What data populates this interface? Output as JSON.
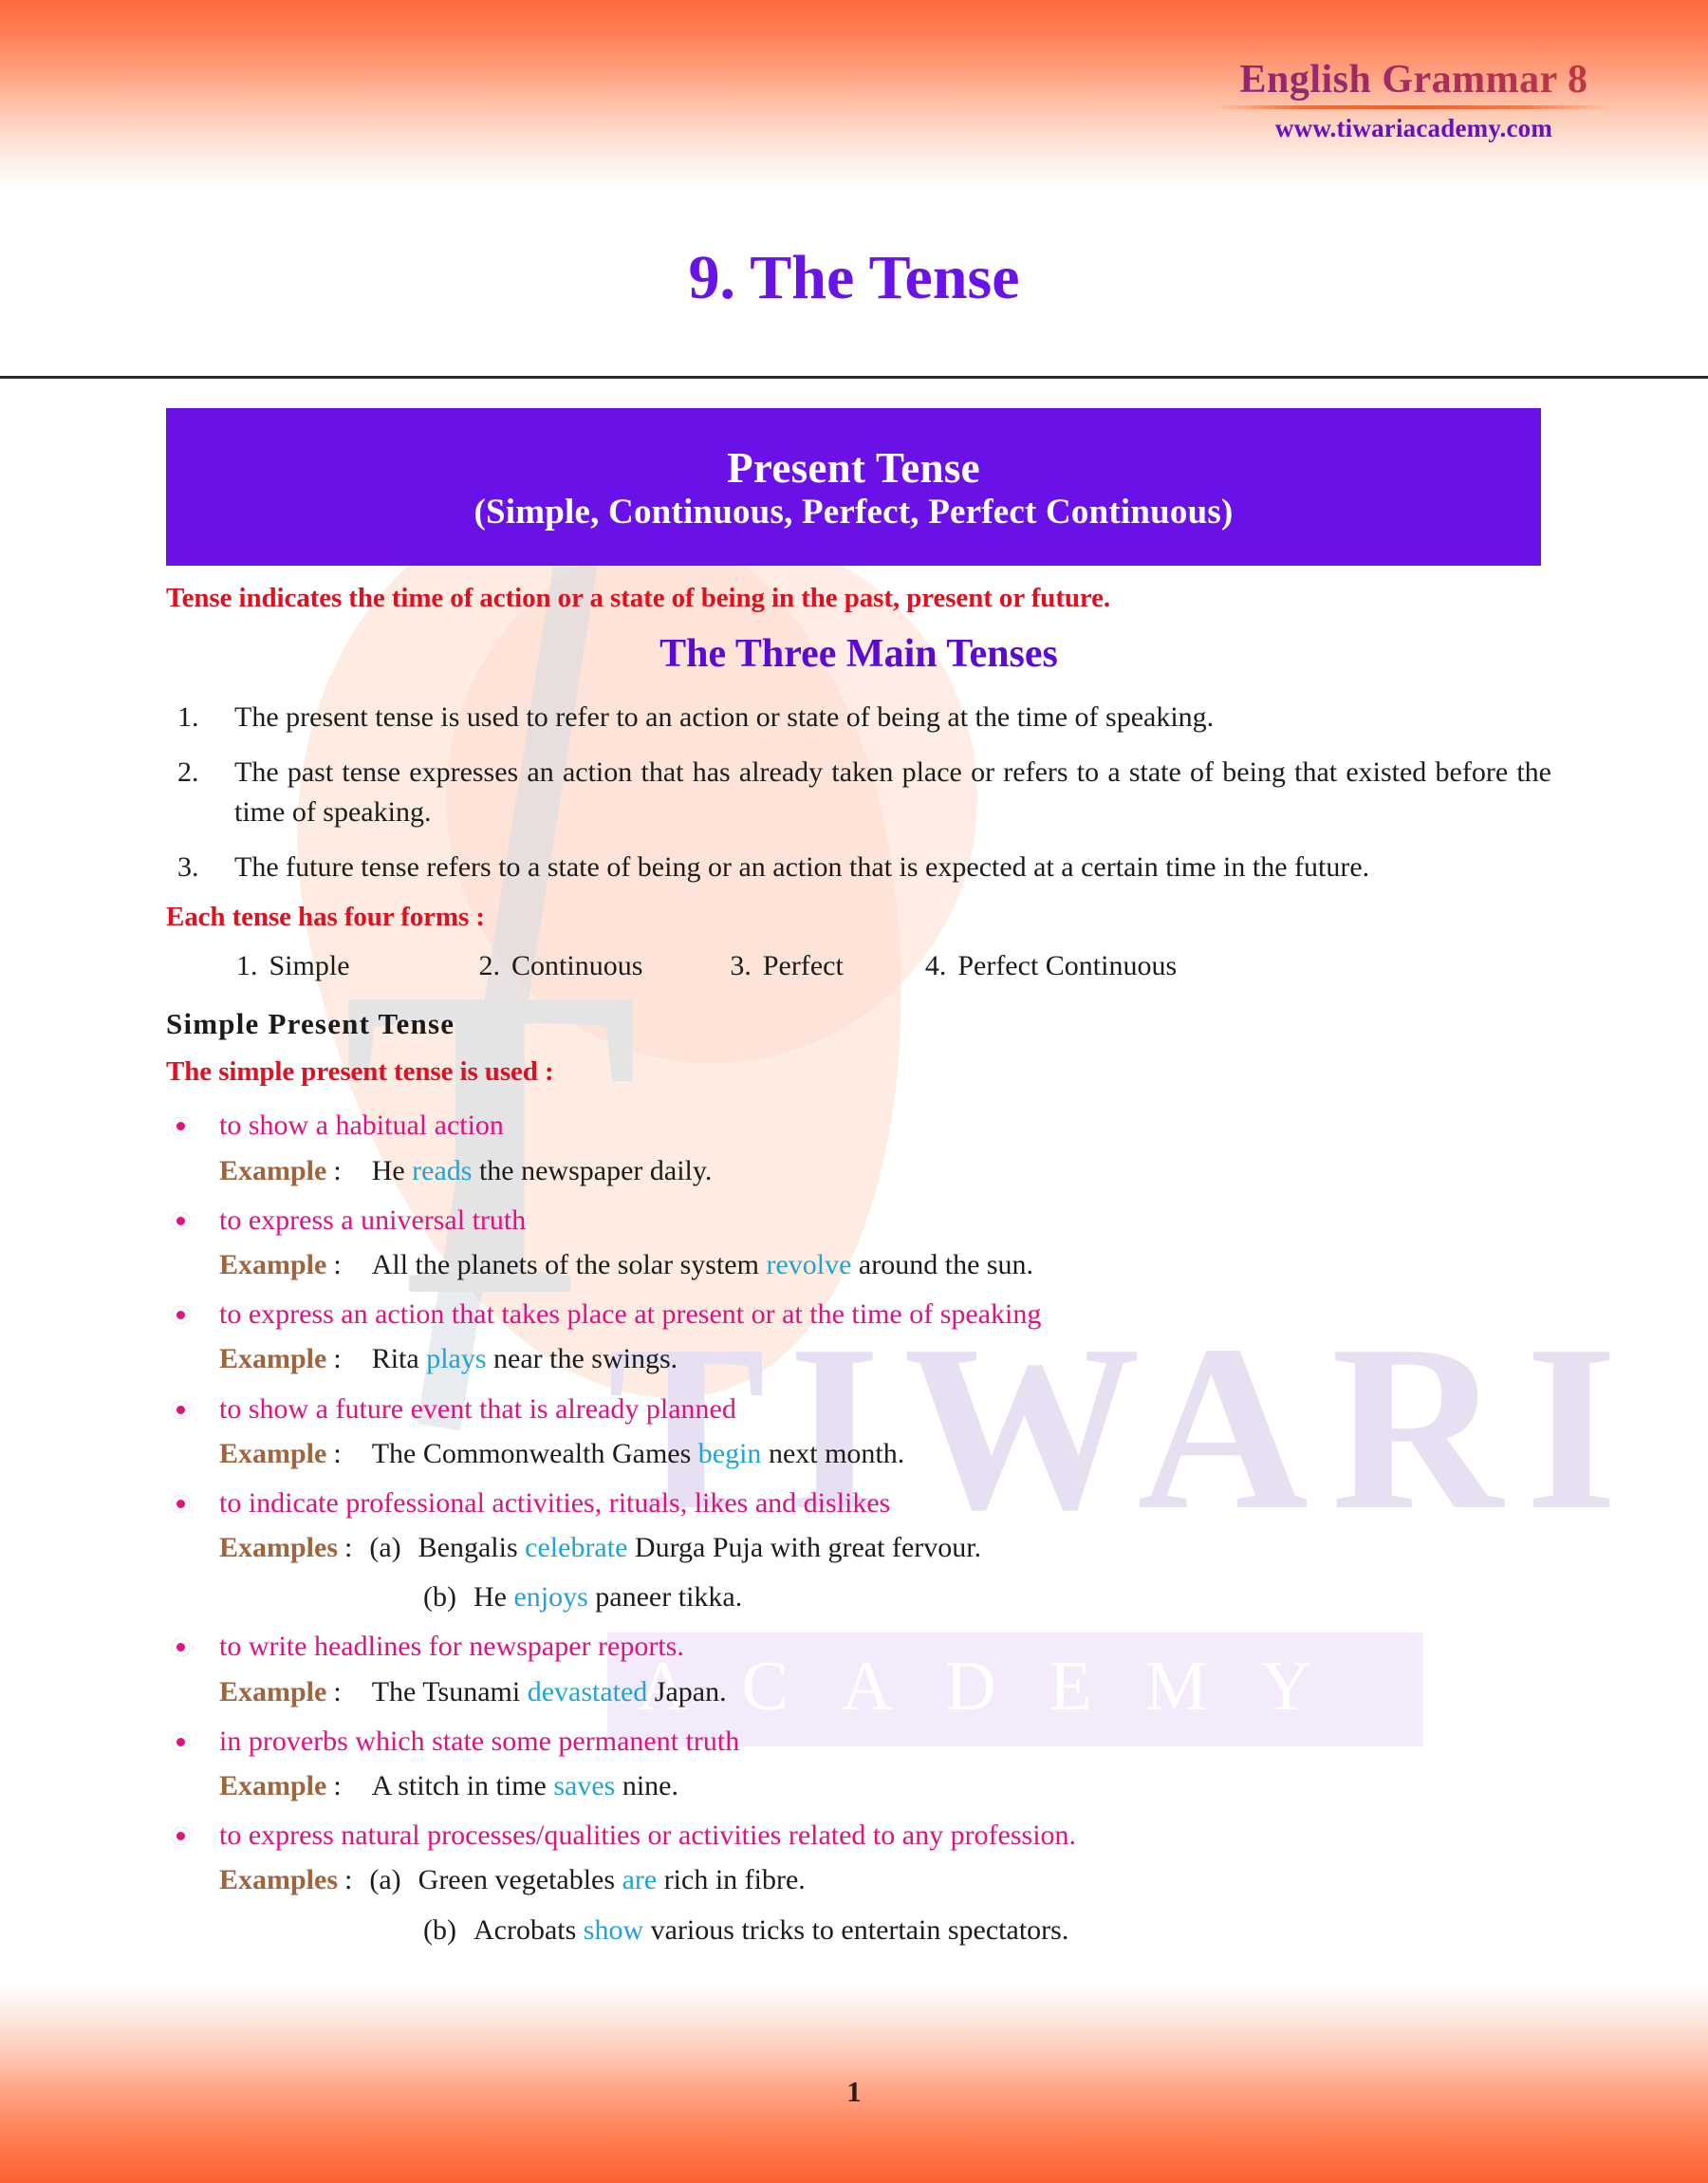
{
  "header": {
    "brand_title": "English Grammar 8",
    "brand_url": "www.tiwariacademy.com"
  },
  "chapter": {
    "title": "9. The Tense"
  },
  "banner": {
    "title": "Present Tense",
    "subtitle": "(Simple, Continuous, Perfect, Perfect Continuous)"
  },
  "intro": {
    "lead": "Tense indicates the time of action or a state of being in the past, present or future.",
    "section_heading": "The Three Main Tenses",
    "main_list": [
      "The present tense is used to refer to an action or state of being at the time of speaking.",
      "The past tense expresses an action that has already taken place or refers to a state of being that existed before the time of speaking.",
      "The future tense refers to a state of being or an action that is expected at a certain time in the future."
    ]
  },
  "forms": {
    "lead": "Each tense has four forms :",
    "items": [
      {
        "num": "1.",
        "label": "Simple"
      },
      {
        "num": "2.",
        "label": "Continuous"
      },
      {
        "num": "3.",
        "label": "Perfect"
      },
      {
        "num": "4.",
        "label": "Perfect Continuous"
      }
    ]
  },
  "simple_present": {
    "heading": "Simple Present Tense",
    "lead": "The simple present tense is used :",
    "bullets": [
      {
        "text": "to show a habitual action",
        "example_label": "Example",
        "examples": [
          {
            "marker": "",
            "before": "He ",
            "verb": "reads",
            "after": " the newspaper daily."
          }
        ]
      },
      {
        "text": "to express a universal truth",
        "example_label": "Example",
        "examples": [
          {
            "marker": "",
            "before": "All the planets of the solar system ",
            "verb": "revolve",
            "after": " around the sun."
          }
        ]
      },
      {
        "text": "to express an action that takes place at present or at the time of speaking",
        "example_label": "Example",
        "examples": [
          {
            "marker": "",
            "before": "Rita ",
            "verb": "plays",
            "after": " near the swings."
          }
        ]
      },
      {
        "text": "to show a future event that is already planned",
        "example_label": "Example",
        "examples": [
          {
            "marker": "",
            "before": "The Commonwealth Games ",
            "verb": "begin",
            "after": " next month."
          }
        ]
      },
      {
        "text": "to indicate professional activities, rituals, likes and dislikes",
        "example_label": "Examples",
        "examples": [
          {
            "marker": "(a)",
            "before": "Bengalis ",
            "verb": "celebrate",
            "after": " Durga Puja with great fervour."
          },
          {
            "marker": "(b)",
            "before": "He ",
            "verb": "enjoys",
            "after": " paneer tikka."
          }
        ]
      },
      {
        "text": "to write headlines for newspaper reports.",
        "example_label": "Example",
        "examples": [
          {
            "marker": "",
            "before": "The Tsunami ",
            "verb": "devastated",
            "after": " Japan."
          }
        ]
      },
      {
        "text": "in proverbs which state some permanent truth",
        "example_label": "Example",
        "examples": [
          {
            "marker": "",
            "before": "A stitch in time ",
            "verb": "saves",
            "after": " nine."
          }
        ]
      },
      {
        "text": "to express natural processes/qualities or activities related to any profession.",
        "example_label": "Examples",
        "examples": [
          {
            "marker": "(a)",
            "before": "Green vegetables ",
            "verb": "are",
            "after": " rich in fibre."
          },
          {
            "marker": "(b)",
            "before": "Acrobats ",
            "verb": "show",
            "after": " various tricks to entertain spectators."
          }
        ]
      }
    ]
  },
  "footer": {
    "page_number": "1"
  },
  "watermark": {
    "letter": "T",
    "brand": "TIWARI",
    "sub_brand": "ACADEMY"
  },
  "colors": {
    "banner_purple": "#6a11e8",
    "title_purple": "#6914e6",
    "heading_purple": "#5c0ad0",
    "lead_red": "#e01020",
    "bullet_pink": "#e3117e",
    "verb_blue": "#20a3d6",
    "example_brown": "#a0643f",
    "gradient_orange": "#ff6a3c"
  }
}
